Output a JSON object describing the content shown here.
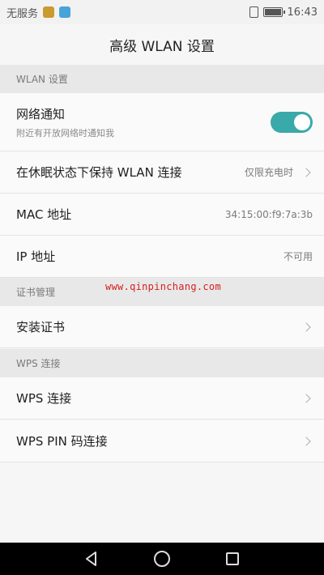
{
  "status_bar": {
    "carrier": "无服务",
    "time": "16:43",
    "notif_colors": [
      "#c99a2e",
      "#48a4d8"
    ]
  },
  "title": "高级 WLAN 设置",
  "sections": {
    "wlan": {
      "header": "WLAN 设置",
      "network_notify": {
        "label": "网络通知",
        "sublabel": "附近有开放网络时通知我",
        "toggle_on": true
      },
      "keep_wlan": {
        "label": "在休眠状态下保持 WLAN 连接",
        "value": "仅限充电时"
      },
      "mac": {
        "label": "MAC 地址",
        "value": "34:15:00:f9:7a:3b"
      },
      "ip": {
        "label": "IP 地址",
        "value": "不可用"
      }
    },
    "cert": {
      "header": "证书管理",
      "install": {
        "label": "安装证书"
      }
    },
    "wps": {
      "header": "WPS 连接",
      "wps_connect": {
        "label": "WPS 连接"
      },
      "wps_pin": {
        "label": "WPS PIN 码连接"
      }
    }
  },
  "watermark": "www.qinpinchang.com",
  "accent_color": "#3aa9a9"
}
